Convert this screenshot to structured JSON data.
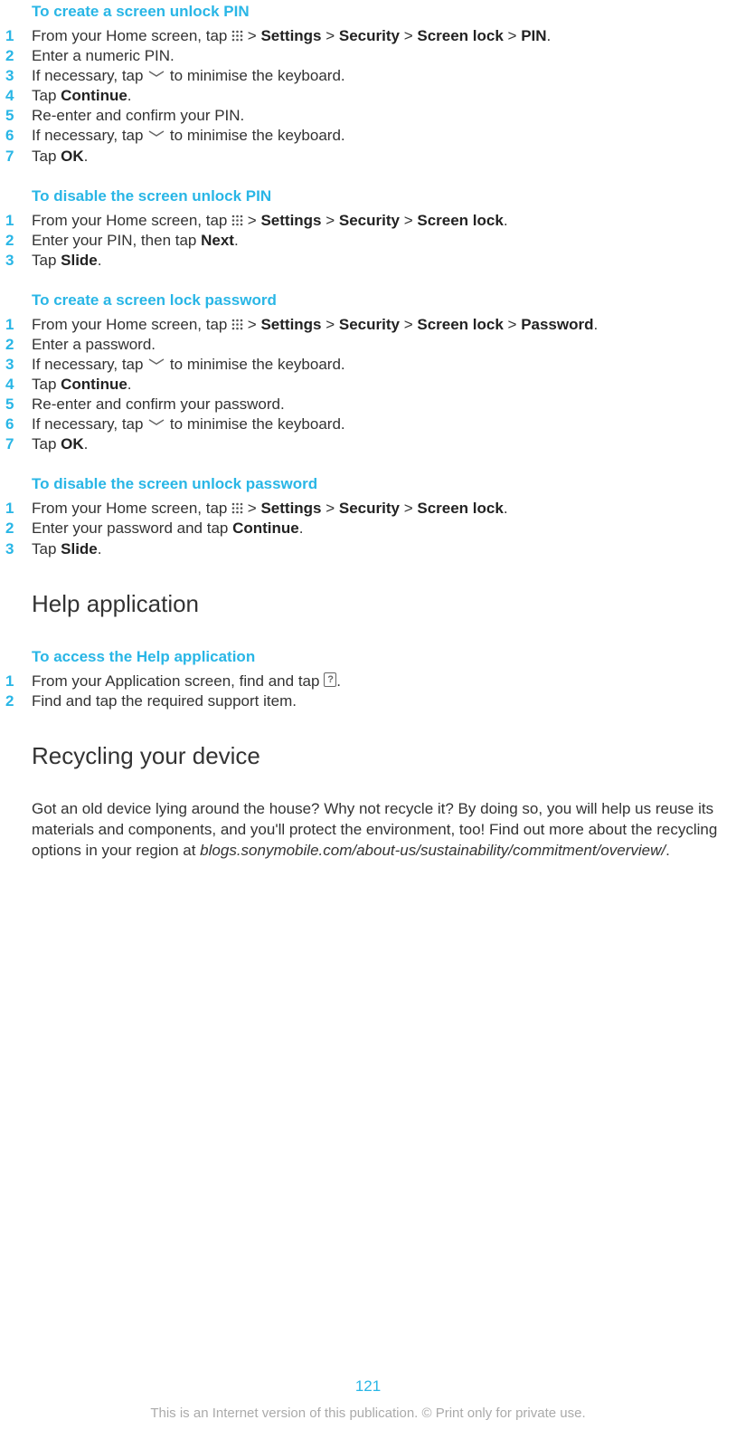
{
  "sections": [
    {
      "heading": "To create a screen unlock PIN",
      "steps": [
        {
          "num": "1",
          "parts": [
            {
              "t": "From your Home screen, tap "
            },
            {
              "icon": "apps"
            },
            {
              "t": " > "
            },
            {
              "b": "Settings"
            },
            {
              "t": " > "
            },
            {
              "b": "Security"
            },
            {
              "t": " > "
            },
            {
              "b": "Screen lock"
            },
            {
              "t": " > "
            },
            {
              "b": "PIN"
            },
            {
              "t": "."
            }
          ]
        },
        {
          "num": "2",
          "parts": [
            {
              "t": "Enter a numeric PIN."
            }
          ]
        },
        {
          "num": "3",
          "parts": [
            {
              "t": "If necessary, tap "
            },
            {
              "icon": "down"
            },
            {
              "t": " to minimise the keyboard."
            }
          ]
        },
        {
          "num": "4",
          "parts": [
            {
              "t": "Tap "
            },
            {
              "b": "Continue"
            },
            {
              "t": "."
            }
          ]
        },
        {
          "num": "5",
          "parts": [
            {
              "t": "Re-enter and confirm your PIN."
            }
          ]
        },
        {
          "num": "6",
          "parts": [
            {
              "t": "If necessary, tap "
            },
            {
              "icon": "down"
            },
            {
              "t": " to minimise the keyboard."
            }
          ]
        },
        {
          "num": "7",
          "parts": [
            {
              "t": "Tap "
            },
            {
              "b": "OK"
            },
            {
              "t": "."
            }
          ]
        }
      ]
    },
    {
      "heading": "To disable the screen unlock PIN",
      "steps": [
        {
          "num": "1",
          "parts": [
            {
              "t": "From your Home screen, tap "
            },
            {
              "icon": "apps"
            },
            {
              "t": " > "
            },
            {
              "b": "Settings"
            },
            {
              "t": " > "
            },
            {
              "b": "Security"
            },
            {
              "t": " > "
            },
            {
              "b": "Screen lock"
            },
            {
              "t": "."
            }
          ]
        },
        {
          "num": "2",
          "parts": [
            {
              "t": "Enter your PIN, then tap "
            },
            {
              "b": "Next"
            },
            {
              "t": "."
            }
          ]
        },
        {
          "num": "3",
          "parts": [
            {
              "t": "Tap "
            },
            {
              "b": "Slide"
            },
            {
              "t": "."
            }
          ]
        }
      ]
    },
    {
      "heading": "To create a screen lock password",
      "steps": [
        {
          "num": "1",
          "parts": [
            {
              "t": "From your Home screen, tap "
            },
            {
              "icon": "apps"
            },
            {
              "t": " > "
            },
            {
              "b": "Settings"
            },
            {
              "t": " > "
            },
            {
              "b": "Security"
            },
            {
              "t": " > "
            },
            {
              "b": "Screen lock"
            },
            {
              "t": " > "
            },
            {
              "b": "Password"
            },
            {
              "t": "."
            }
          ]
        },
        {
          "num": "2",
          "parts": [
            {
              "t": "Enter a password."
            }
          ]
        },
        {
          "num": "3",
          "parts": [
            {
              "t": "If necessary, tap "
            },
            {
              "icon": "down"
            },
            {
              "t": " to minimise the keyboard."
            }
          ]
        },
        {
          "num": "4",
          "parts": [
            {
              "t": "Tap "
            },
            {
              "b": "Continue"
            },
            {
              "t": "."
            }
          ]
        },
        {
          "num": "5",
          "parts": [
            {
              "t": "Re-enter and confirm your password."
            }
          ]
        },
        {
          "num": "6",
          "parts": [
            {
              "t": "If necessary, tap "
            },
            {
              "icon": "down"
            },
            {
              "t": " to minimise the keyboard."
            }
          ]
        },
        {
          "num": "7",
          "parts": [
            {
              "t": "Tap "
            },
            {
              "b": "OK"
            },
            {
              "t": "."
            }
          ]
        }
      ]
    },
    {
      "heading": "To disable the screen unlock password",
      "steps": [
        {
          "num": "1",
          "parts": [
            {
              "t": "From your Home screen, tap "
            },
            {
              "icon": "apps"
            },
            {
              "t": " > "
            },
            {
              "b": "Settings"
            },
            {
              "t": " > "
            },
            {
              "b": "Security"
            },
            {
              "t": " > "
            },
            {
              "b": "Screen lock"
            },
            {
              "t": "."
            }
          ]
        },
        {
          "num": "2",
          "parts": [
            {
              "t": "Enter your password and tap "
            },
            {
              "b": "Continue"
            },
            {
              "t": "."
            }
          ]
        },
        {
          "num": "3",
          "parts": [
            {
              "t": "Tap "
            },
            {
              "b": "Slide"
            },
            {
              "t": "."
            }
          ]
        }
      ]
    }
  ],
  "help_section": {
    "major_heading": "Help application",
    "sub_heading": "To access the Help application",
    "steps": [
      {
        "num": "1",
        "parts": [
          {
            "t": "From your Application screen, find and tap "
          },
          {
            "icon": "help"
          },
          {
            "t": "."
          }
        ]
      },
      {
        "num": "2",
        "parts": [
          {
            "t": "Find and tap the required support item."
          }
        ]
      }
    ]
  },
  "recycling_section": {
    "major_heading": "Recycling your device",
    "body_parts": [
      {
        "t": "Got an old device lying around the house? Why not recycle it? By doing so, you will help us reuse its materials and components, and you'll protect the environment, too! Find out more about the recycling options in your region at "
      },
      {
        "i": "blogs.sonymobile.com/about-us/sustainability/commitment/overview/"
      },
      {
        "t": "."
      }
    ]
  },
  "page_number": "121",
  "footer": "This is an Internet version of this publication. © Print only for private use."
}
